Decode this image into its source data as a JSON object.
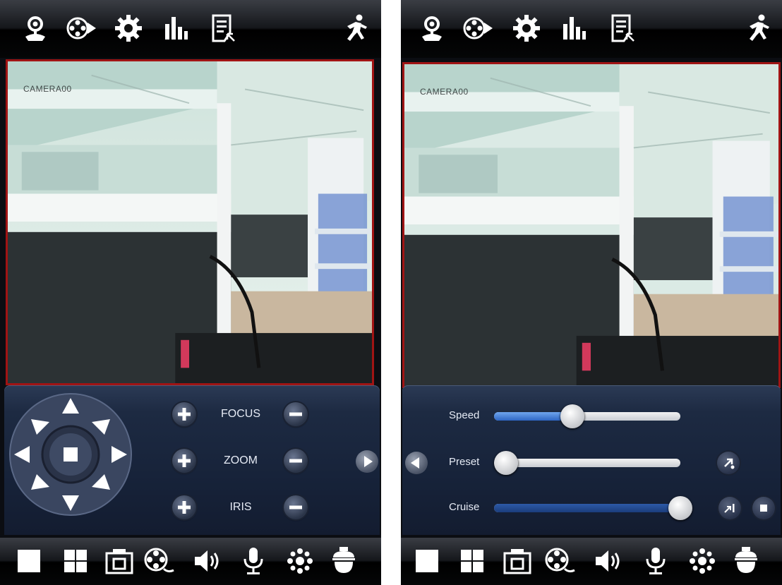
{
  "screens": [
    {
      "camera_label": "CAMERA00",
      "ptz": {
        "focus_label": "FOCUS",
        "zoom_label": "ZOOM",
        "iris_label": "IRIS"
      }
    },
    {
      "camera_label": "CAMERA00",
      "sliders": {
        "speed_label": "Speed",
        "speed_value": 0.42,
        "preset_label": "Preset",
        "preset_value": 0.0,
        "cruise_label": "Cruise",
        "cruise_value": 1.0
      }
    }
  ],
  "top_icons": [
    "ptz-icon",
    "playback-icon",
    "settings-icon",
    "stats-icon",
    "log-icon",
    "exit-icon"
  ],
  "bottom_icons": [
    "single-view-icon",
    "quad-view-icon",
    "snapshot-icon",
    "record-icon",
    "speaker-icon",
    "microphone-icon",
    "brightness-icon",
    "dome-camera-icon"
  ],
  "colors": {
    "video_border": "#a01414",
    "slider_fill": "#3a77d6",
    "panel_bg": "#17233a"
  }
}
